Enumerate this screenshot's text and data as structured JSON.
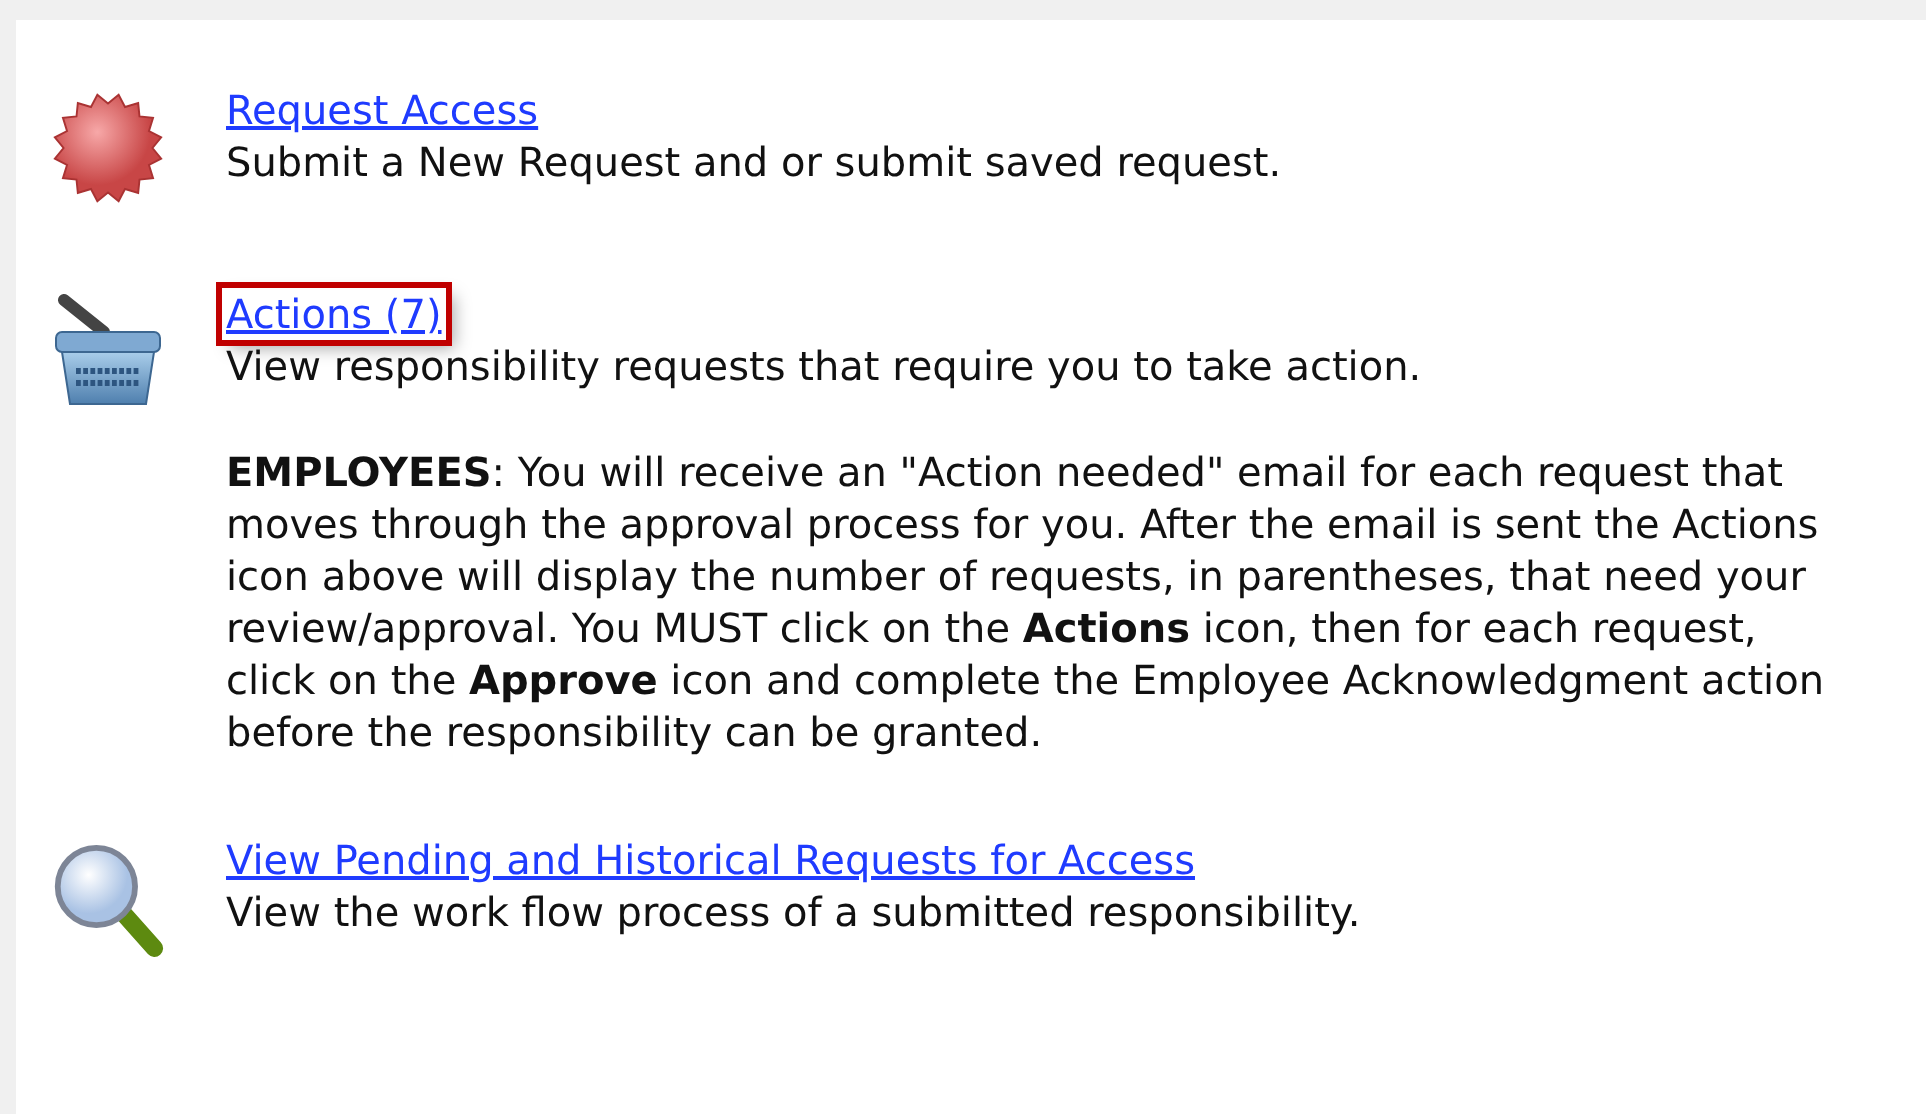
{
  "items": [
    {
      "kind": "badge",
      "link": "Request Access",
      "highlighted": false,
      "description": "Submit a New Request and or submit saved request."
    },
    {
      "kind": "basket",
      "link": "Actions (7)",
      "highlighted": true,
      "description": "View responsibility requests that require you to take action.",
      "note": "**EMPLOYEES**: You will receive an \"Action needed\" email for each request that moves through the approval process for you. After the email is sent the Actions icon above will display the number of requests, in parentheses, that need your review/approval. You MUST click on the **Actions** icon, then for each request, click on the **Approve** icon and complete the Employee Acknowledgment action before the responsibility can be granted."
    },
    {
      "kind": "magnifier",
      "link": "View Pending and Historical Requests for Access",
      "highlighted": false,
      "description": "View the work flow process of a submitted responsibility."
    }
  ]
}
